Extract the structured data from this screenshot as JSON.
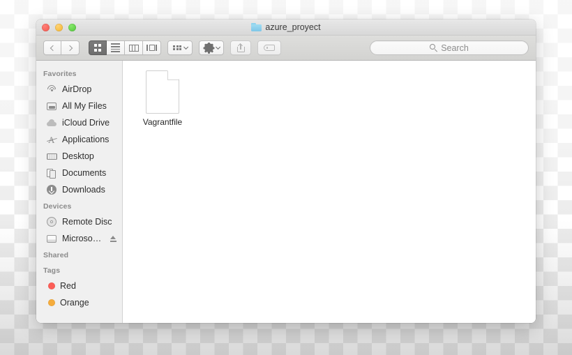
{
  "window": {
    "title": "azure_proyect",
    "folder_icon": "folder-icon",
    "traffic_lights": [
      {
        "name": "close-button",
        "color": "#f2564d"
      },
      {
        "name": "minimize-button",
        "color": "#f2b32e"
      },
      {
        "name": "maximize-button",
        "color": "#4fc43a"
      }
    ]
  },
  "toolbar": {
    "back_icon": "chevron-left-icon",
    "forward_icon": "chevron-right-icon",
    "views": [
      {
        "name": "icon-view-button",
        "icon": "grid-icon",
        "active": true
      },
      {
        "name": "list-view-button",
        "icon": "list-icon",
        "active": false
      },
      {
        "name": "column-view-button",
        "icon": "columns-icon",
        "active": false
      },
      {
        "name": "coverflow-view-button",
        "icon": "coverflow-icon",
        "active": false
      }
    ],
    "arrange_icon": "arrange-grid-icon",
    "action_icon": "gear-icon",
    "dropdown_icon": "chevron-down-icon",
    "share_icon": "share-icon",
    "tag_icon": "tag-icon"
  },
  "search": {
    "icon": "search-icon",
    "placeholder": "Search",
    "value": ""
  },
  "sidebar": {
    "sections": [
      {
        "header": "Favorites",
        "items": [
          {
            "label": "AirDrop",
            "icon": "airdrop-icon"
          },
          {
            "label": "All My Files",
            "icon": "all-my-files-icon"
          },
          {
            "label": "iCloud Drive",
            "icon": "icloud-icon"
          },
          {
            "label": "Applications",
            "icon": "applications-icon"
          },
          {
            "label": "Desktop",
            "icon": "desktop-icon"
          },
          {
            "label": "Documents",
            "icon": "documents-icon"
          },
          {
            "label": "Downloads",
            "icon": "downloads-icon"
          }
        ]
      },
      {
        "header": "Devices",
        "items": [
          {
            "label": "Remote Disc",
            "icon": "disc-icon",
            "eject": false
          },
          {
            "label": "Microso…",
            "icon": "hard-drive-icon",
            "eject": true
          }
        ]
      },
      {
        "header": "Shared",
        "items": []
      },
      {
        "header": "Tags",
        "items": [
          {
            "label": "Red",
            "icon": "tag-dot",
            "color": "#fc5e57"
          },
          {
            "label": "Orange",
            "icon": "tag-dot",
            "color": "#f5ac3c"
          }
        ]
      }
    ]
  },
  "content": {
    "files": [
      {
        "name": "Vagrantfile",
        "icon": "blank-document-icon"
      }
    ]
  }
}
